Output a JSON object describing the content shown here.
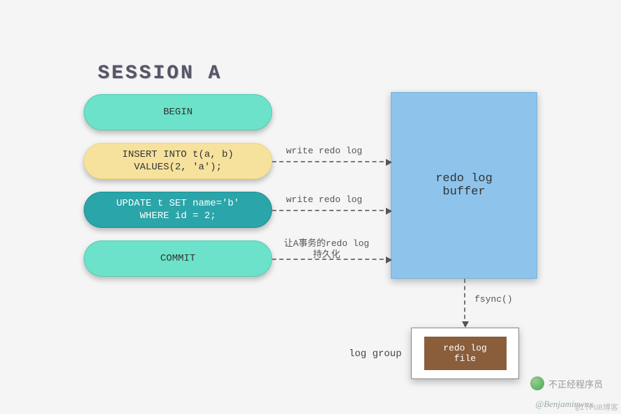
{
  "title": "SESSION A",
  "steps": {
    "begin": "BEGIN",
    "insert": "INSERT INTO t(a, b)\nVALUES(2, 'a');",
    "update": "UPDATE t SET name='b'\nWHERE id = 2;",
    "commit": "COMMIT"
  },
  "arrows": {
    "insert": "write redo log",
    "update": "write redo log",
    "commit": "让A事务的redo log\n持久化",
    "fsync": "fsync()"
  },
  "buffer": "redo log\nbuffer",
  "log_group": "log group",
  "file": "redo log\nfile",
  "credit": "@Benjaminwnx",
  "watermark": "不正经程序员",
  "corner_wm": "@ITPUB博客",
  "chart_data": {
    "type": "flow-diagram",
    "session": "SESSION A",
    "nodes": [
      {
        "id": "begin",
        "label": "BEGIN",
        "kind": "step"
      },
      {
        "id": "insert",
        "label": "INSERT INTO t(a, b) VALUES(2, 'a');",
        "kind": "step"
      },
      {
        "id": "update",
        "label": "UPDATE t SET name='b' WHERE id = 2;",
        "kind": "step"
      },
      {
        "id": "commit",
        "label": "COMMIT",
        "kind": "step"
      },
      {
        "id": "buffer",
        "label": "redo log buffer",
        "kind": "memory"
      },
      {
        "id": "file",
        "label": "redo log file",
        "kind": "disk",
        "group": "log group"
      }
    ],
    "edges": [
      {
        "from": "insert",
        "to": "buffer",
        "label": "write redo log"
      },
      {
        "from": "update",
        "to": "buffer",
        "label": "write redo log"
      },
      {
        "from": "commit",
        "to": "buffer",
        "label": "让A事务的redo log 持久化"
      },
      {
        "from": "buffer",
        "to": "file",
        "label": "fsync()"
      }
    ]
  }
}
